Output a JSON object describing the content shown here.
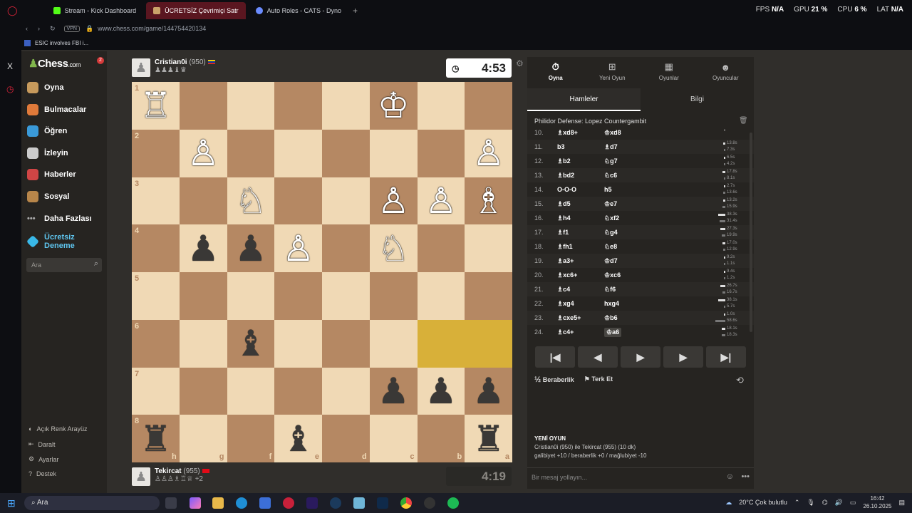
{
  "browser": {
    "tabs": [
      {
        "label": "Stream - Kick Dashboard",
        "color": "#53fc18"
      },
      {
        "label": "ÜCRETSİZ Çevrimiçi Satr",
        "color": "#caa36a",
        "active": true
      },
      {
        "label": "Auto Roles - CATS - Dyno",
        "color": "#6b8cff"
      }
    ],
    "stats": {
      "fps_label": "FPS",
      "fps": "N/A",
      "gpu_label": "GPU",
      "gpu": "21 %",
      "cpu_label": "CPU",
      "cpu": "6 %",
      "lat_label": "LAT",
      "lat": "N/A"
    },
    "url": "www.chess.com/game/144754420134",
    "vpn": "VPN",
    "bookmark": "ESIC involves FBI i..."
  },
  "sidebar": {
    "logo": "Chess",
    "logo_suffix": ".com",
    "badge": "2",
    "items": [
      {
        "label": "Oyna",
        "color": "#c79a5c"
      },
      {
        "label": "Bulmacalar",
        "color": "#e07a3a"
      },
      {
        "label": "Öğren",
        "color": "#3a9ad9"
      },
      {
        "label": "İzleyin",
        "color": "#cccccc"
      },
      {
        "label": "Haberler",
        "color": "#d04545"
      },
      {
        "label": "Sosyal",
        "color": "#b8864a"
      },
      {
        "label": "Daha Fazlası",
        "color": "#888888"
      },
      {
        "label": "Ücretsiz Deneme",
        "color": "#39b8e8"
      }
    ],
    "search_placeholder": "Ara",
    "bottom": [
      "Açık Renk Arayüz",
      "Daralt",
      "Ayarlar",
      "Destek"
    ]
  },
  "top_player": {
    "name": "Cristian0i",
    "rating": "(950)",
    "captured": "♟♟♟♝♛",
    "clock": "4:53"
  },
  "bottom_player": {
    "name": "Tekircat",
    "rating": "(955)",
    "captured": "♙♙♙♗♖♕",
    "plus": "+2",
    "clock": "4:19"
  },
  "board": {
    "ranks": [
      "1",
      "2",
      "3",
      "4",
      "5",
      "6",
      "7",
      "8"
    ],
    "files": [
      "h",
      "g",
      "f",
      "e",
      "d",
      "c",
      "b",
      "a"
    ],
    "rows": [
      [
        "wR",
        "",
        "",
        "",
        "",
        "wK",
        "",
        ""
      ],
      [
        "",
        "wP",
        "",
        "",
        "",
        "",
        "",
        "wP"
      ],
      [
        "",
        "",
        "wN",
        "",
        "",
        "wP",
        "wP",
        "wB"
      ],
      [
        "",
        "bP",
        "bP",
        "wP",
        "",
        "wN",
        "",
        ""
      ],
      [
        "",
        "",
        "",
        "",
        "",
        "",
        "",
        ""
      ],
      [
        "",
        "",
        "bB",
        "",
        "",
        "",
        "",
        ""
      ],
      [
        "",
        "",
        "",
        "",
        "",
        "bP",
        "bP",
        "bP"
      ],
      [
        "bR",
        "",
        "",
        "bB",
        "",
        "",
        "",
        "bR"
      ]
    ],
    "highlight": [
      [
        5,
        6
      ],
      [
        5,
        7
      ]
    ]
  },
  "panel": {
    "tabs": [
      {
        "label": "Oyna",
        "icon": "⏱"
      },
      {
        "label": "Yeni Oyun",
        "icon": "⊞"
      },
      {
        "label": "Oyunlar",
        "icon": "▦"
      },
      {
        "label": "Oyuncular",
        "icon": "👥"
      }
    ],
    "subtabs": [
      "Hamleler",
      "Bilgi"
    ],
    "opening": "Philidor Defense: Lopez Countergambit",
    "moves": [
      {
        "n": "10.",
        "w": "♗xd8+",
        "b": "♔xd8",
        "t1": "0.1s",
        "t2": ""
      },
      {
        "n": "11.",
        "w": "b3",
        "b": "♗d7",
        "t1": "13.8s",
        "t2": "7.3s"
      },
      {
        "n": "12.",
        "w": "♗b2",
        "b": "♘g7",
        "t1": "6.5s",
        "t2": "4.2s"
      },
      {
        "n": "13.",
        "w": "♗bd2",
        "b": "♘c6",
        "t1": "17.8s",
        "t2": "8.1s"
      },
      {
        "n": "14.",
        "w": "O-O-O",
        "b": "h5",
        "t1": "2.7s",
        "t2": "13.6s"
      },
      {
        "n": "15.",
        "w": "♗d5",
        "b": "♔e7",
        "t1": "13.2s",
        "t2": "15.9s"
      },
      {
        "n": "16.",
        "w": "♗h4",
        "b": "♘xf2",
        "t1": "38.3s",
        "t2": "31.4s"
      },
      {
        "n": "17.",
        "w": "♗f1",
        "b": "♘g4",
        "t1": "27.3s",
        "t2": "19.9s"
      },
      {
        "n": "18.",
        "w": "♗fh1",
        "b": "♘e8",
        "t1": "17.0s",
        "t2": "12.9s"
      },
      {
        "n": "19.",
        "w": "♗a3+",
        "b": "♔d7",
        "t1": "9.2s",
        "t2": "1.1s"
      },
      {
        "n": "20.",
        "w": "♗xc6+",
        "b": "♔xc6",
        "t1": "9.4s",
        "t2": "1.2s"
      },
      {
        "n": "21.",
        "w": "♗c4",
        "b": "♘f6",
        "t1": "26.7s",
        "t2": "16.7s"
      },
      {
        "n": "22.",
        "w": "♗xg4",
        "b": "hxg4",
        "t1": "38.1s",
        "t2": "5.7s"
      },
      {
        "n": "23.",
        "w": "♗cxe5+",
        "b": "♔b6",
        "t1": "1.0s",
        "t2": "58.6s"
      },
      {
        "n": "24.",
        "w": "♗c4+",
        "b": "♔a6",
        "t1": "18.1s",
        "t2": "18.3s"
      }
    ],
    "controls": [
      "|◀",
      "◀",
      "▶",
      "▶",
      "▶|"
    ],
    "draw": "Beraberlik",
    "draw_icon": "½",
    "resign": "Terk Et",
    "newgame_title": "YENİ OYUN",
    "newgame_line": "Cristian0i (950) ile Tekircat (955) (10 dk)",
    "newgame_result": "galibiyet +10 / beraberlik +0 / mağlubiyet -10",
    "chat_placeholder": "Bir mesaj yollayın..."
  },
  "taskbar": {
    "search": "Ara",
    "weather": "20°C  Çok bulutlu",
    "time": "16:42",
    "date": "26.10.2025"
  }
}
